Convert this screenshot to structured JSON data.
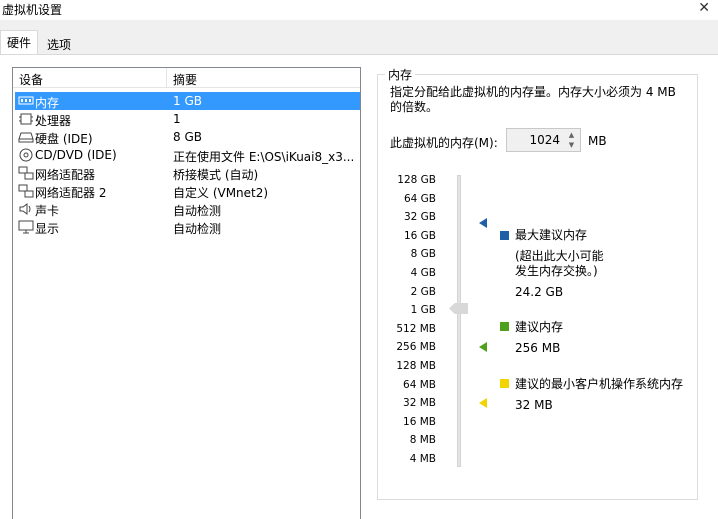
{
  "window": {
    "title": "虚拟机设置"
  },
  "tabs": [
    {
      "label": "硬件"
    },
    {
      "label": "选项"
    }
  ],
  "devices": {
    "header": {
      "device": "设备",
      "summary": "摘要"
    },
    "items": [
      {
        "name": "内存",
        "summary": "1 GB",
        "icon": "memory-icon"
      },
      {
        "name": "处理器",
        "summary": "1",
        "icon": "cpu-icon"
      },
      {
        "name": "硬盘 (IDE)",
        "summary": "8 GB",
        "icon": "harddisk-icon"
      },
      {
        "name": "CD/DVD (IDE)",
        "summary": "正在使用文件 E:\\OS\\iKuai8_x3...",
        "icon": "cd-icon"
      },
      {
        "name": "网络适配器",
        "summary": "桥接模式 (自动)",
        "icon": "network-icon"
      },
      {
        "name": "网络适配器 2",
        "summary": "自定义 (VMnet2)",
        "icon": "network-icon"
      },
      {
        "name": "声卡",
        "summary": "自动检测",
        "icon": "sound-icon"
      },
      {
        "name": "显示",
        "summary": "自动检测",
        "icon": "display-icon"
      }
    ]
  },
  "memory": {
    "group_title": "内存",
    "description": "指定分配给此虚拟机的内存量。内存大小必须为 4 MB 的倍数。",
    "label": "此虚拟机的内存(M):",
    "value": "1024",
    "unit": "MB",
    "scale": [
      "128 GB",
      "64 GB",
      "32 GB",
      "16 GB",
      "8 GB",
      "4 GB",
      "2 GB",
      "1 GB",
      "512 MB",
      "256 MB",
      "128 MB",
      "64 MB",
      "32 MB",
      "16 MB",
      "8 MB",
      "4 MB"
    ],
    "max_recommended": {
      "title": "最大建议内存",
      "note_line1": "(超出此大小可能",
      "note_line2": "发生内存交换。)",
      "value": "24.2 GB",
      "color": "#1e5fa8"
    },
    "recommended": {
      "title": "建议内存",
      "value": "256 MB",
      "color": "#4fa01c"
    },
    "min_guest": {
      "title": "建议的最小客户机操作系统内存",
      "value": "32 MB",
      "color": "#f1d400"
    }
  }
}
